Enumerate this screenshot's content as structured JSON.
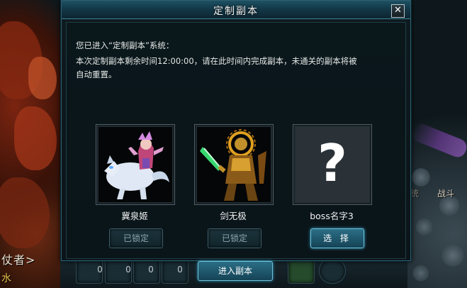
{
  "dialog": {
    "title": "定制副本",
    "close_label": "✕",
    "intro_line": "您已进入“定制副本”系统：",
    "detail_line1": "本次定制副本剩余时间12:00:00，请在此时间内完成副本，未通关的副本将被",
    "detail_line2": "自动重置。",
    "bosses": [
      {
        "name": "冀泉姬",
        "button_label": "已锁定",
        "state": "locked"
      },
      {
        "name": "剑无极",
        "button_label": "已锁定",
        "state": "locked"
      },
      {
        "name": "boss名字3",
        "button_label": "选 择",
        "state": "selectable",
        "placeholder": "?"
      }
    ],
    "enter_label": "进入副本"
  },
  "world": {
    "left_text": "仗者>",
    "left_text2": "水",
    "right_text": "战斗",
    "right_text2": "统"
  },
  "hotbar": {
    "counts": [
      "0",
      "0",
      "0",
      "0"
    ]
  },
  "colors": {
    "frame_border": "#2f6070",
    "titlebar": "#1d5163",
    "button_active": "#2b6e86",
    "button_disabled": "#1d343c"
  }
}
